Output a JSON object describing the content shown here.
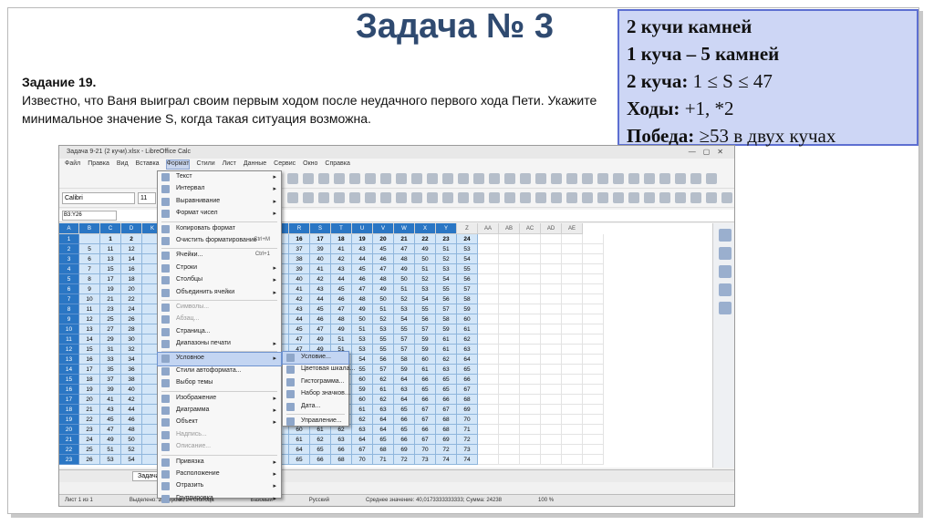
{
  "slide": {
    "title": "Задача № 3",
    "task_heading": "Задание 19.",
    "task_text": "Известно, что Ваня выиграл своим первым ходом после неудачного первого хода Пети. Укажите минимальное значение S, когда такая ситуация возможна."
  },
  "infobox": {
    "line1": "2 кучи камней",
    "line2": "1 куча – 5 камней",
    "line3_label": "2 куча:",
    "line3_value": " 1 ≤ S ≤ 47",
    "line4_label": "Ходы:",
    "line4_value": " +1, *2",
    "line5_label": "Победа:",
    "line5_value": " ≥53 в двух кучах"
  },
  "app": {
    "window_title": "Задача 9-21 (2 кучи).xlsx - LibreOffice Calc",
    "menubar": [
      "Файл",
      "Правка",
      "Вид",
      "Вставка",
      "Формат",
      "Стили",
      "Лист",
      "Данные",
      "Сервис",
      "Окно",
      "Справка"
    ],
    "font_name": "Calibri",
    "font_size": "11",
    "name_box": "B3:Y26",
    "col_headers": [
      "A",
      "B",
      "C",
      "D",
      "",
      "",
      "",
      "",
      "",
      "",
      "",
      "K",
      "L",
      "M",
      "N",
      "O",
      "P",
      "Q",
      "R",
      "S",
      "T",
      "U",
      "V",
      "W",
      "X",
      "Y",
      "Z",
      "AA",
      "AB",
      "AC",
      "AD",
      "AE"
    ],
    "row_numbers": [
      "1",
      "2",
      "3",
      "4",
      "5",
      "6",
      "7",
      "8",
      "9",
      "10",
      "11",
      "12",
      "13",
      "14",
      "15",
      "16",
      "17",
      "18",
      "19",
      "20",
      "21",
      "22",
      "23",
      "24",
      "25",
      "26"
    ],
    "sheet_tab": "Задача 3",
    "status_left": "Лист 1 из 1",
    "status_selection": "Выделено: 24 строки, 24 столбца",
    "status_style": "Базовый",
    "status_lang": "Русский",
    "status_sum": "Среднее значение: 40,0173333333333; Сумма: 24238",
    "status_zoom": "100 %"
  },
  "format_menu": {
    "items": [
      {
        "label": "Текст",
        "arrow": true,
        "dis": false
      },
      {
        "label": "Интервал",
        "arrow": true,
        "dis": false
      },
      {
        "label": "Выравнивание",
        "arrow": true,
        "dis": false
      },
      {
        "label": "Формат чисел",
        "arrow": true,
        "dis": false
      },
      {
        "sep": true
      },
      {
        "label": "Копировать формат",
        "dis": false
      },
      {
        "label": "Очистить форматирование",
        "shortcut": "Ctrl+M",
        "dis": false
      },
      {
        "sep": true
      },
      {
        "label": "Ячейки...",
        "shortcut": "Ctrl+1",
        "dis": false
      },
      {
        "label": "Строки",
        "arrow": true,
        "dis": false
      },
      {
        "label": "Столбцы",
        "arrow": true,
        "dis": false
      },
      {
        "label": "Объединить ячейки",
        "arrow": true,
        "dis": false
      },
      {
        "sep": true
      },
      {
        "label": "Символы...",
        "dis": true
      },
      {
        "label": "Абзац...",
        "dis": true
      },
      {
        "label": "Страница...",
        "dis": false
      },
      {
        "label": "Диапазоны печати",
        "arrow": true,
        "dis": false
      },
      {
        "sep": true
      },
      {
        "label": "Условное",
        "arrow": true,
        "dis": false,
        "hl": true
      },
      {
        "label": "Стили автоформата...",
        "dis": false
      },
      {
        "label": "Выбор темы",
        "dis": false
      },
      {
        "sep": true
      },
      {
        "label": "Изображение",
        "arrow": true,
        "dis": false
      },
      {
        "label": "Диаграмма",
        "arrow": true,
        "dis": false
      },
      {
        "label": "Объект",
        "arrow": true,
        "dis": false
      },
      {
        "label": "Надпись...",
        "dis": true
      },
      {
        "label": "Описание...",
        "dis": true
      },
      {
        "sep": true
      },
      {
        "label": "Привязка",
        "arrow": true,
        "dis": false
      },
      {
        "label": "Расположение",
        "arrow": true,
        "dis": false
      },
      {
        "label": "Отразить",
        "arrow": true,
        "dis": false
      },
      {
        "label": "Группировка",
        "arrow": true,
        "dis": false
      }
    ]
  },
  "conditional_submenu": {
    "items": [
      {
        "label": "Условие...",
        "hl": true
      },
      {
        "label": "Цветовая шкала..."
      },
      {
        "label": "Гистограмма..."
      },
      {
        "label": "Набор значков..."
      },
      {
        "label": "Дата..."
      },
      {
        "sep": true
      },
      {
        "label": "Управление..."
      }
    ]
  },
  "table": {
    "col_index_row": [
      "",
      "1",
      "2",
      "3",
      "",
      "",
      "",
      "",
      "",
      "",
      "",
      "10",
      "11",
      "12",
      "13",
      "14",
      "15",
      "16",
      "17",
      "18",
      "19",
      "20",
      "21",
      "22",
      "23",
      "24"
    ],
    "body": [
      [
        "5",
        "11",
        "12",
        "13",
        "",
        "",
        "",
        "",
        "",
        "",
        "",
        "25",
        "27",
        "29",
        "31",
        "33",
        "35",
        "37",
        "39",
        "41",
        "43",
        "45",
        "47",
        "49",
        "51",
        "53"
      ],
      [
        "6",
        "13",
        "14",
        "15",
        "",
        "",
        "",
        "",
        "",
        "",
        "",
        "26",
        "28",
        "30",
        "32",
        "34",
        "36",
        "38",
        "40",
        "42",
        "44",
        "46",
        "48",
        "50",
        "52",
        "54"
      ],
      [
        "7",
        "15",
        "16",
        "17",
        "",
        "",
        "",
        "",
        "",
        "",
        "",
        "27",
        "29",
        "31",
        "33",
        "35",
        "37",
        "39",
        "41",
        "43",
        "45",
        "47",
        "49",
        "51",
        "53",
        "55"
      ],
      [
        "8",
        "17",
        "18",
        "19",
        "",
        "",
        "",
        "",
        "",
        "",
        "",
        "28",
        "30",
        "32",
        "34",
        "36",
        "38",
        "40",
        "42",
        "44",
        "46",
        "48",
        "50",
        "52",
        "54",
        "56"
      ],
      [
        "9",
        "19",
        "20",
        "21",
        "",
        "",
        "",
        "",
        "",
        "",
        "",
        "29",
        "31",
        "33",
        "35",
        "37",
        "39",
        "41",
        "43",
        "45",
        "47",
        "49",
        "51",
        "53",
        "55",
        "57"
      ],
      [
        "10",
        "21",
        "22",
        "23",
        "",
        "",
        "",
        "",
        "",
        "",
        "",
        "30",
        "32",
        "34",
        "36",
        "38",
        "40",
        "42",
        "44",
        "46",
        "48",
        "50",
        "52",
        "54",
        "56",
        "58"
      ],
      [
        "11",
        "23",
        "24",
        "25",
        "",
        "",
        "",
        "",
        "",
        "",
        "",
        "32",
        "33",
        "35",
        "37",
        "39",
        "41",
        "43",
        "45",
        "47",
        "49",
        "51",
        "53",
        "55",
        "57",
        "59"
      ],
      [
        "12",
        "25",
        "26",
        "27",
        "",
        "",
        "",
        "",
        "",
        "",
        "",
        "32",
        "34",
        "36",
        "38",
        "40",
        "42",
        "44",
        "46",
        "48",
        "50",
        "52",
        "54",
        "56",
        "58",
        "60"
      ],
      [
        "13",
        "27",
        "28",
        "29",
        "",
        "",
        "",
        "",
        "",
        "",
        "",
        "34",
        "35",
        "37",
        "39",
        "41",
        "43",
        "45",
        "47",
        "49",
        "51",
        "53",
        "55",
        "57",
        "59",
        "61"
      ],
      [
        "14",
        "29",
        "30",
        "31",
        "",
        "",
        "",
        "",
        "",
        "",
        "",
        "38",
        "39",
        "40",
        "41",
        "43",
        "45",
        "47",
        "49",
        "51",
        "53",
        "55",
        "57",
        "59",
        "61",
        "62"
      ],
      [
        "15",
        "31",
        "32",
        "33",
        "",
        "",
        "",
        "",
        "",
        "",
        "",
        "",
        "",
        "",
        "",
        "45",
        "46",
        "47",
        "49",
        "51",
        "53",
        "55",
        "57",
        "59",
        "61",
        "63"
      ],
      [
        "16",
        "33",
        "34",
        "35",
        "",
        "",
        "",
        "",
        "",
        "",
        "",
        "",
        "",
        "",
        "",
        "46",
        "47",
        "48",
        "50",
        "52",
        "54",
        "56",
        "58",
        "60",
        "62",
        "64"
      ],
      [
        "17",
        "35",
        "36",
        "37",
        "",
        "",
        "",
        "",
        "",
        "",
        "",
        "",
        "",
        "",
        "",
        "47",
        "48",
        "49",
        "51",
        "53",
        "55",
        "57",
        "59",
        "61",
        "63",
        "65"
      ],
      [
        "18",
        "37",
        "38",
        "39",
        "",
        "",
        "",
        "",
        "",
        "",
        "",
        "",
        "",
        "",
        "",
        "50",
        "52",
        "54",
        "56",
        "58",
        "60",
        "62",
        "64",
        "66",
        "65",
        "66"
      ],
      [
        "19",
        "39",
        "40",
        "41",
        "",
        "",
        "",
        "",
        "",
        "",
        "",
        "",
        "",
        "",
        "",
        "52",
        "53",
        "54",
        "55",
        "57",
        "59",
        "61",
        "63",
        "65",
        "65",
        "67"
      ],
      [
        "20",
        "41",
        "42",
        "43",
        "",
        "",
        "",
        "",
        "",
        "",
        "",
        "",
        "",
        "",
        "",
        "53",
        "54",
        "56",
        "57",
        "59",
        "60",
        "62",
        "64",
        "66",
        "66",
        "68"
      ],
      [
        "21",
        "43",
        "44",
        "45",
        "",
        "",
        "",
        "",
        "",
        "",
        "",
        "",
        "",
        "",
        "",
        "55",
        "56",
        "57",
        "58",
        "60",
        "61",
        "63",
        "65",
        "67",
        "67",
        "69"
      ],
      [
        "22",
        "45",
        "46",
        "47",
        "",
        "",
        "",
        "",
        "",
        "",
        "",
        "",
        "",
        "",
        "",
        "56",
        "57",
        "58",
        "59",
        "61",
        "62",
        "64",
        "66",
        "67",
        "68",
        "70"
      ],
      [
        "23",
        "47",
        "48",
        "49",
        "",
        "",
        "",
        "",
        "",
        "",
        "",
        "",
        "",
        "",
        "",
        "58",
        "59",
        "60",
        "61",
        "62",
        "63",
        "64",
        "65",
        "66",
        "68",
        "71"
      ],
      [
        "24",
        "49",
        "50",
        "51",
        "",
        "",
        "",
        "",
        "",
        "",
        "",
        "",
        "",
        "57",
        "58",
        "59",
        "60",
        "61",
        "62",
        "63",
        "64",
        "65",
        "66",
        "67",
        "69",
        "72"
      ],
      [
        "25",
        "51",
        "52",
        "53",
        "",
        "",
        "",
        "",
        "",
        "",
        "",
        "58",
        "59",
        "60",
        "61",
        "62",
        "63",
        "64",
        "65",
        "66",
        "67",
        "68",
        "69",
        "70",
        "72",
        "73"
      ],
      [
        "26",
        "53",
        "54",
        "55",
        "",
        "",
        "",
        "",
        "",
        "",
        "",
        "",
        "60",
        "61",
        "62",
        "63",
        "64",
        "65",
        "66",
        "68",
        "70",
        "71",
        "72",
        "73",
        "74",
        "74"
      ]
    ]
  }
}
